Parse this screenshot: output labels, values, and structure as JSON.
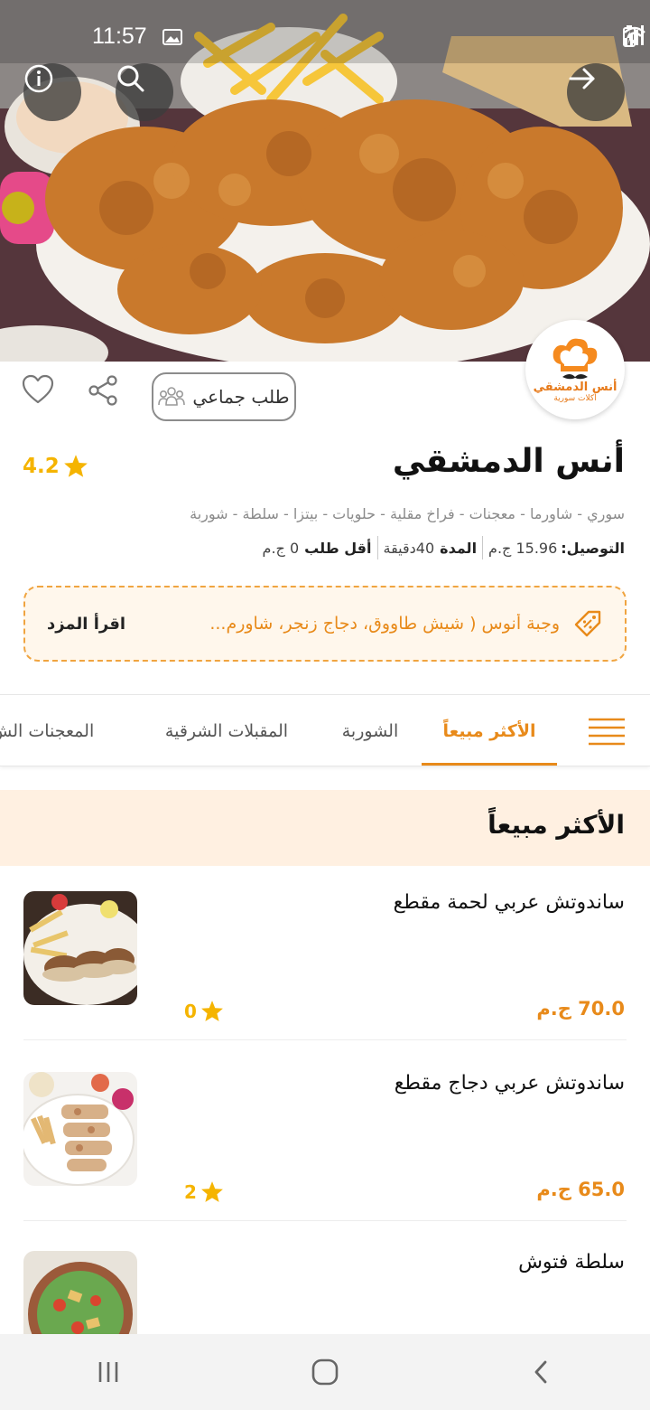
{
  "status_bar": {
    "time": "11:57"
  },
  "restaurant": {
    "name": "أنس الدمشقي",
    "rating": "4.2",
    "cuisines": "سوري - شاورما - معجنات - فراخ مقلية - حلويات - بيتزا - سلطة - شوربة",
    "delivery_label": "التوصيل:",
    "delivery_value": "15.96 ج.م",
    "duration_label": "المدة",
    "duration_value": "40دقيقة",
    "min_order_label": "أقل طلب",
    "min_order_value": "0 ج.م",
    "logo_name": "أنس الدمشقي",
    "logo_sub": "أكلات سورية"
  },
  "actions": {
    "group_order": "طلب جماعي"
  },
  "offer": {
    "text": "وجبة أنوس ( شيش طاووق، دجاج زنجر، شاورم...",
    "read_more": "اقرأ المزد"
  },
  "tabs": [
    {
      "label": "الأكثر مبيعاً",
      "active": true
    },
    {
      "label": "الشوربة",
      "active": false
    },
    {
      "label": "المقبلات الشرقية",
      "active": false
    },
    {
      "label": "المعجنات الش",
      "active": false
    }
  ],
  "section": {
    "title": "الأكثر مبيعاً"
  },
  "items": [
    {
      "name": "ساندوتش عربي لحمة مقطع",
      "price": "70.0 ج.م",
      "rating": "0"
    },
    {
      "name": "ساندوتش عربي دجاج مقطع",
      "price": "65.0 ج.م",
      "rating": "2"
    },
    {
      "name": "سلطة فتوش",
      "price": "",
      "rating": ""
    }
  ],
  "colors": {
    "accent": "#e88a1a",
    "star": "#f5b400",
    "offer_bg": "#fff7ec",
    "section_bg": "#fff0e1"
  },
  "icons": [
    "info-icon",
    "search-icon",
    "arrow-right-icon",
    "heart-icon",
    "share-icon",
    "group-icon",
    "star-icon",
    "tag-icon",
    "menu-icon"
  ]
}
